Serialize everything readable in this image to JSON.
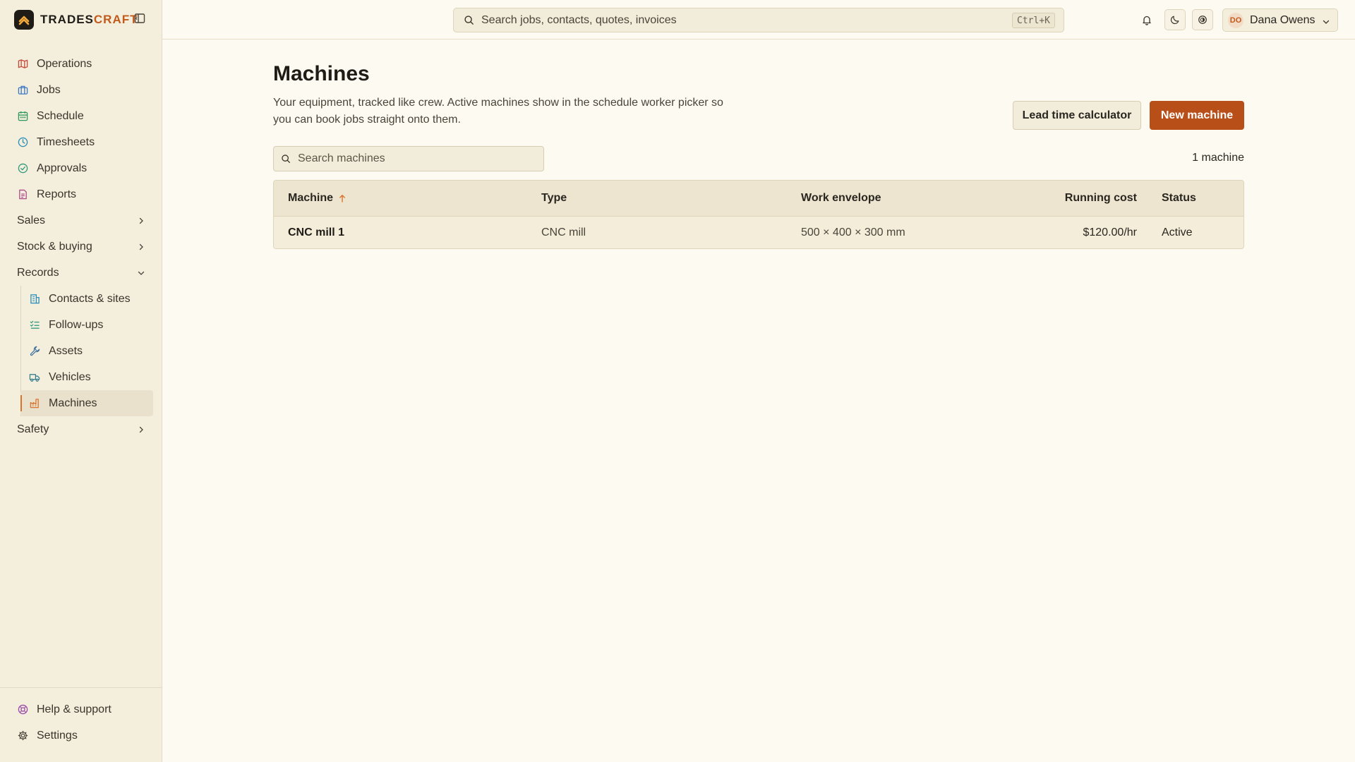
{
  "brand": {
    "name_a": "TRADES",
    "name_b": "CRAFT"
  },
  "sidebar": {
    "items": [
      {
        "label": "Operations"
      },
      {
        "label": "Jobs"
      },
      {
        "label": "Schedule"
      },
      {
        "label": "Timesheets"
      },
      {
        "label": "Approvals"
      },
      {
        "label": "Reports"
      }
    ],
    "groups": {
      "sales": "Sales",
      "stock": "Stock & buying",
      "records": "Records",
      "safety": "Safety"
    },
    "records_items": [
      {
        "label": "Contacts & sites"
      },
      {
        "label": "Follow-ups"
      },
      {
        "label": "Assets"
      },
      {
        "label": "Vehicles"
      },
      {
        "label": "Machines"
      }
    ],
    "bottom": {
      "help": "Help & support",
      "settings": "Settings"
    }
  },
  "topbar": {
    "search_placeholder": "Search jobs, contacts, quotes, invoices",
    "shortcut": "Ctrl+K",
    "user": {
      "initials": "DO",
      "name": "Dana Owens"
    }
  },
  "page": {
    "title": "Machines",
    "description": "Your equipment, tracked like crew. Active machines show in the schedule worker picker so you can book jobs straight onto them.",
    "lead_time_button": "Lead time calculator",
    "new_button": "New machine",
    "search_placeholder": "Search machines",
    "count": "1 machine"
  },
  "table": {
    "columns": {
      "machine": "Machine",
      "type": "Type",
      "envelope": "Work envelope",
      "cost": "Running cost",
      "status": "Status"
    },
    "rows": [
      {
        "machine": "CNC mill 1",
        "type": "CNC mill",
        "envelope": "500 × 400 × 300 mm",
        "cost": "$120.00/hr",
        "status": "Active"
      }
    ]
  },
  "colors": {
    "accent": "#b84f18",
    "sidebar_bg": "#f4eedd",
    "page_bg": "#fdfaf2"
  }
}
